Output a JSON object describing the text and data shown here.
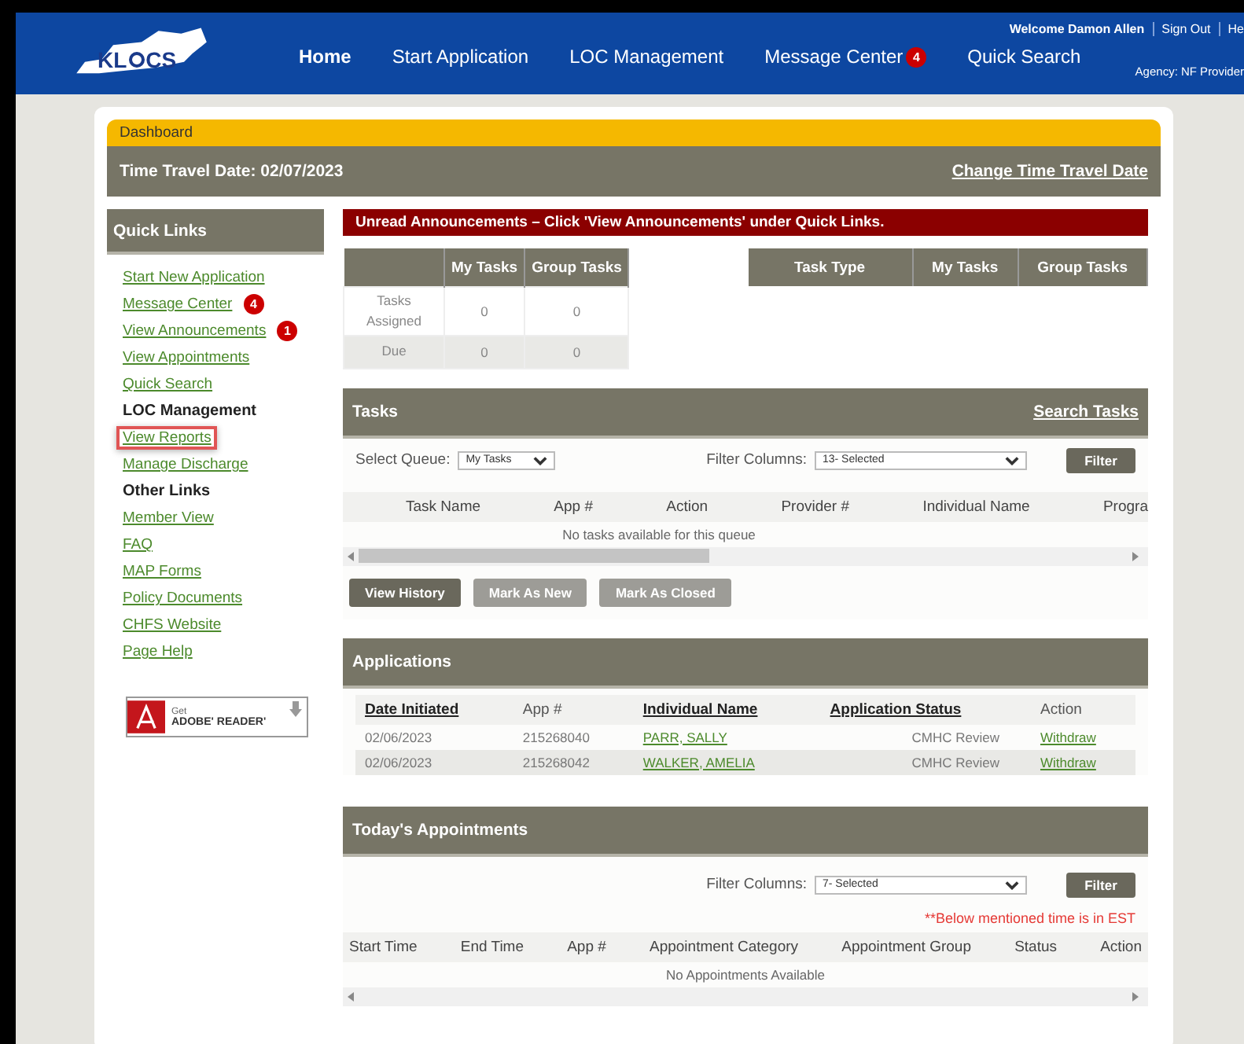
{
  "header": {
    "logo": {
      "left": "KL",
      "right": "CS"
    },
    "nav": [
      {
        "label": "Home",
        "selected": true
      },
      {
        "label": "Start Application",
        "selected": false
      },
      {
        "label": "LOC Management",
        "selected": false
      },
      {
        "label": "Message Center",
        "badge": "4",
        "selected": false
      },
      {
        "label": "Quick Search",
        "selected": false
      }
    ],
    "user_links": [
      "Welcome Damon Allen",
      "Sign Out",
      "He"
    ],
    "agency": "Agency: NF Provider"
  },
  "breadcrumb": "Dashboard",
  "time_travel": {
    "label": "Time Travel Date: 02/07/2023",
    "link": "Change Time Travel Date"
  },
  "quick_links": {
    "title": "Quick Links",
    "items": [
      {
        "kind": "link",
        "label": "Start New Application",
        "highlighted": false
      },
      {
        "kind": "link",
        "label": "Message Center",
        "badge": "4",
        "highlighted": false
      },
      {
        "kind": "link",
        "label": "View Announcements",
        "badge": "1",
        "highlighted": false
      },
      {
        "kind": "link",
        "label": "View Appointments",
        "highlighted": false
      },
      {
        "kind": "link",
        "label": "Quick Search",
        "highlighted": false
      },
      {
        "kind": "heading",
        "label": "LOC Management",
        "highlighted": false
      },
      {
        "kind": "link",
        "label": "View Reports",
        "highlighted": true
      },
      {
        "kind": "link",
        "label": "Manage Discharge",
        "highlighted": false
      },
      {
        "kind": "heading",
        "label": "Other Links",
        "highlighted": false
      },
      {
        "kind": "link",
        "label": "Member View",
        "highlighted": false
      },
      {
        "kind": "link",
        "label": "FAQ",
        "highlighted": false
      },
      {
        "kind": "link",
        "label": "MAP Forms",
        "highlighted": false
      },
      {
        "kind": "link",
        "label": "Policy Documents",
        "highlighted": false
      },
      {
        "kind": "link",
        "label": "CHFS Website",
        "highlighted": false
      },
      {
        "kind": "link",
        "label": "Page Help",
        "highlighted": false
      }
    ],
    "adobe": {
      "small": "Get",
      "big": "ADOBE' READER'"
    }
  },
  "announcement": "Unread Announcements – Click 'View Announcements' under Quick Links.",
  "task_summary": {
    "columns": [
      "My Tasks",
      "Group Tasks"
    ],
    "rows": [
      {
        "label": "Tasks Assigned",
        "values": [
          "0",
          "0"
        ]
      },
      {
        "label": "Due",
        "values": [
          "0",
          "0"
        ]
      }
    ]
  },
  "task_type": {
    "columns": [
      "Task Type",
      "My Tasks",
      "Group Tasks"
    ]
  },
  "tasks": {
    "title": "Tasks",
    "link": "Search Tasks",
    "queue_label": "Select Queue:",
    "queue_value": "My Tasks",
    "filter_label": "Filter Columns:",
    "filter_value": "13- Selected",
    "filter_button": "Filter",
    "columns": [
      "Task Name",
      "App #",
      "Action",
      "Provider #",
      "Individual Name",
      "Progra"
    ],
    "empty": "No tasks available for this queue",
    "buttons": [
      {
        "label": "View History",
        "disabled": false
      },
      {
        "label": "Mark As New",
        "disabled": true
      },
      {
        "label": "Mark As Closed",
        "disabled": true
      }
    ]
  },
  "applications": {
    "title": "Applications",
    "columns": [
      {
        "label": "Date Initiated",
        "sortable": true
      },
      {
        "label": "App #",
        "sortable": false
      },
      {
        "label": "Individual Name",
        "sortable": true
      },
      {
        "label": "Application Status",
        "sortable": true
      },
      {
        "label": "Action",
        "sortable": false
      }
    ],
    "rows": [
      [
        "02/06/2023",
        "215268040",
        "PARR, SALLY",
        "CMHC Review",
        "Withdraw"
      ],
      [
        "02/06/2023",
        "215268042",
        "WALKER, AMELIA",
        "CMHC Review",
        "Withdraw"
      ]
    ]
  },
  "appointments": {
    "title": "Today's Appointments",
    "filter_label": "Filter Columns:",
    "filter_value": "7- Selected",
    "filter_button": "Filter",
    "note": "**Below mentioned time is in EST",
    "columns": [
      "Start Time",
      "End Time",
      "App #",
      "Appointment Category",
      "Appointment Group",
      "Status",
      "Action"
    ],
    "empty": "No Appointments Available"
  }
}
